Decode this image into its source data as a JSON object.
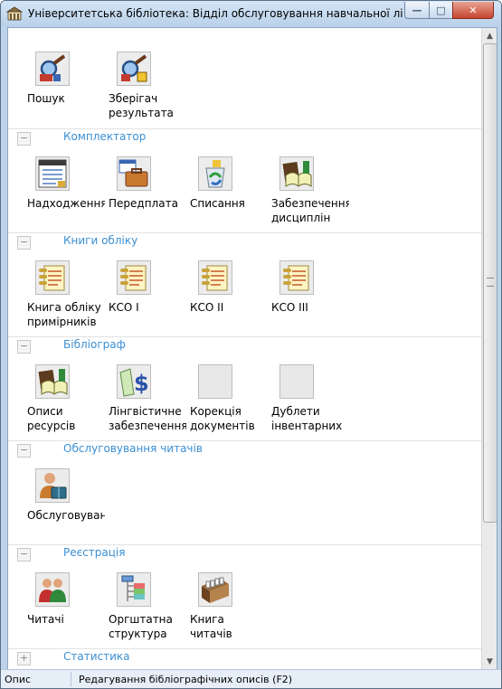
{
  "window": {
    "title": "Університетська бібліотека: Відділ обслуговування навчальної літератур...",
    "minimize": "—",
    "maximize": "□",
    "close": "✕"
  },
  "top_items": [
    {
      "label": "Пошук",
      "icon": "search-magnifier-icon"
    },
    {
      "label": "Зберігач\nрезультата",
      "icon": "results-keeper-icon"
    }
  ],
  "sections": [
    {
      "title": "Комплектатор",
      "toggle": "−",
      "items": [
        {
          "label": "Надходження",
          "icon": "receipts-calendar-icon"
        },
        {
          "label": "Передплата",
          "icon": "subscription-briefcase-icon"
        },
        {
          "label": "Списання",
          "icon": "write-off-recycle-icon"
        },
        {
          "label": "Забезпечення\nдисциплін",
          "icon": "books-icon"
        }
      ]
    },
    {
      "title": "Книги обліку",
      "toggle": "−",
      "items": [
        {
          "label": "Книга обліку\nпримірників",
          "icon": "ledger-icon"
        },
        {
          "label": "КСО I",
          "icon": "ledger-icon"
        },
        {
          "label": "КСО II",
          "icon": "ledger-icon"
        },
        {
          "label": "КСО III",
          "icon": "ledger-icon"
        }
      ]
    },
    {
      "title": "Бібліограф",
      "toggle": "−",
      "items": [
        {
          "label": "Описи\nресурсів",
          "icon": "books-icon"
        },
        {
          "label": "Лінгвістичне\nзабезпечення",
          "icon": "linguistic-dollar-icon"
        },
        {
          "label": "Корекція\nдокументів",
          "icon": "blank-icon"
        },
        {
          "label": "Дублети\nінвентарних\nномерів",
          "icon": "blank-icon"
        }
      ]
    },
    {
      "title": "Обслуговування читачів",
      "toggle": "−",
      "items": [
        {
          "label": "Обслуговування",
          "icon": "reader-service-icon"
        }
      ]
    },
    {
      "title": "Реєстрація",
      "toggle": "−",
      "items": [
        {
          "label": "Читачі",
          "icon": "readers-icon"
        },
        {
          "label": "Оргштатна\nструктура",
          "icon": "org-structure-icon"
        },
        {
          "label": "Книга\nчитачів",
          "icon": "card-box-icon"
        }
      ]
    },
    {
      "title": "Статистика",
      "toggle": "+",
      "items": []
    }
  ],
  "status": {
    "left": "Опис",
    "right": "Редагування бібліографічних описів (F2)"
  }
}
